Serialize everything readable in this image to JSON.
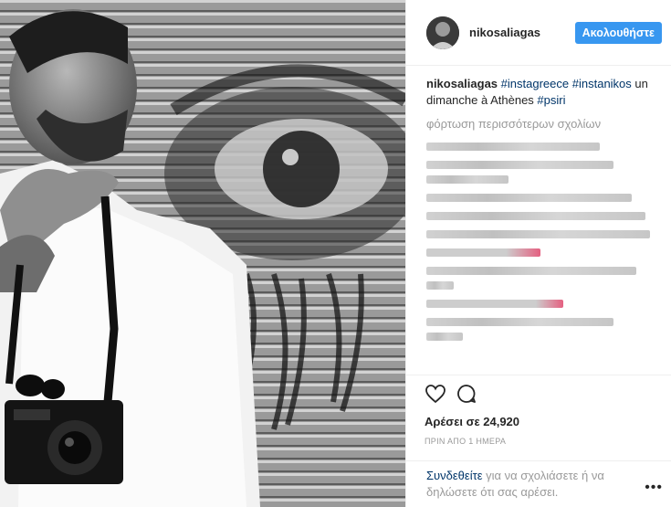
{
  "header": {
    "username": "nikosaliagas",
    "follow_label": "Ακολουθήστε"
  },
  "caption": {
    "username": "nikosaliagas",
    "tag1": "#instagreece",
    "tag2": "#instanikos",
    "text": " un dimanche à Athènes ",
    "tag3": "#psiri"
  },
  "comments": {
    "load_more": "φόρτωση περισσότερων σχολίων",
    "note": "blurred",
    "colors": {
      "heart": "#e0446a",
      "accent": "#3897f0",
      "link": "#003569"
    }
  },
  "actions": {
    "likes": "Αρέσει σε 24,920",
    "time": "ΠΡΙΝ ΑΠΟ 1 ΗΜΕΡΑ",
    "icons": [
      "heart-icon",
      "comment-icon"
    ]
  },
  "footer": {
    "login": "Συνδεθείτε",
    "text": " για να σχολιάσετε ή να δηλώσετε ότι σας αρέσει.",
    "more": "•••"
  }
}
